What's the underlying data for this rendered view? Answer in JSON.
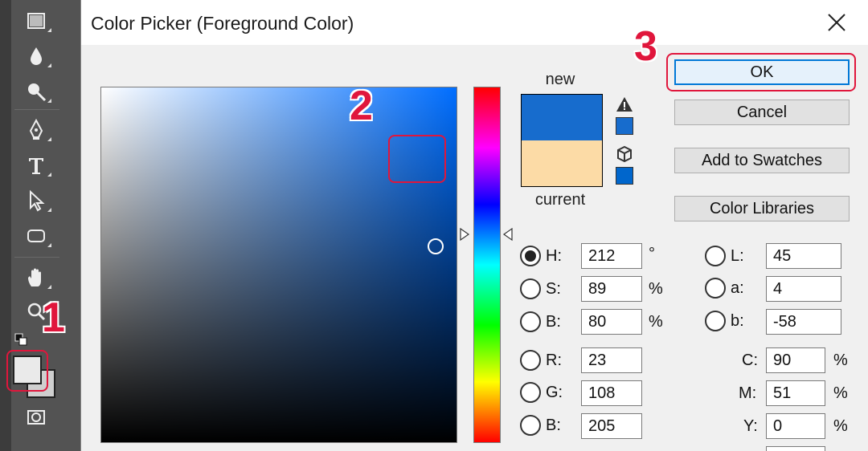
{
  "dialog": {
    "title": "Color Picker (Foreground Color)"
  },
  "swatches": {
    "new_label": "new",
    "current_label": "current",
    "new_color": "#176CCD",
    "current_color": "#FCDBA6"
  },
  "buttons": {
    "ok": "OK",
    "cancel": "Cancel",
    "add_to_swatches": "Add to Swatches",
    "color_libraries": "Color Libraries"
  },
  "hsb": [
    {
      "label": "H:",
      "value": "212",
      "unit": "°",
      "selected": true
    },
    {
      "label": "S:",
      "value": "89",
      "unit": "%",
      "selected": false
    },
    {
      "label": "B:",
      "value": "80",
      "unit": "%",
      "selected": false
    }
  ],
  "rgb": [
    {
      "label": "R:",
      "value": "23"
    },
    {
      "label": "G:",
      "value": "108"
    },
    {
      "label": "B:",
      "value": "205"
    }
  ],
  "lab": [
    {
      "label": "L:",
      "value": "45"
    },
    {
      "label": "a:",
      "value": "4"
    },
    {
      "label": "b:",
      "value": "-58"
    }
  ],
  "cmyk": [
    {
      "label": "C:",
      "value": "90",
      "unit": "%"
    },
    {
      "label": "M:",
      "value": "51",
      "unit": "%"
    },
    {
      "label": "Y:",
      "value": "0",
      "unit": "%"
    }
  ],
  "annotations": {
    "step1": "1",
    "step2": "2",
    "step3": "3",
    "color": "#E0163C"
  },
  "icons": {
    "warning": "gamut-warning-icon",
    "web": "web-safe-cube-icon",
    "close": "close-icon"
  }
}
